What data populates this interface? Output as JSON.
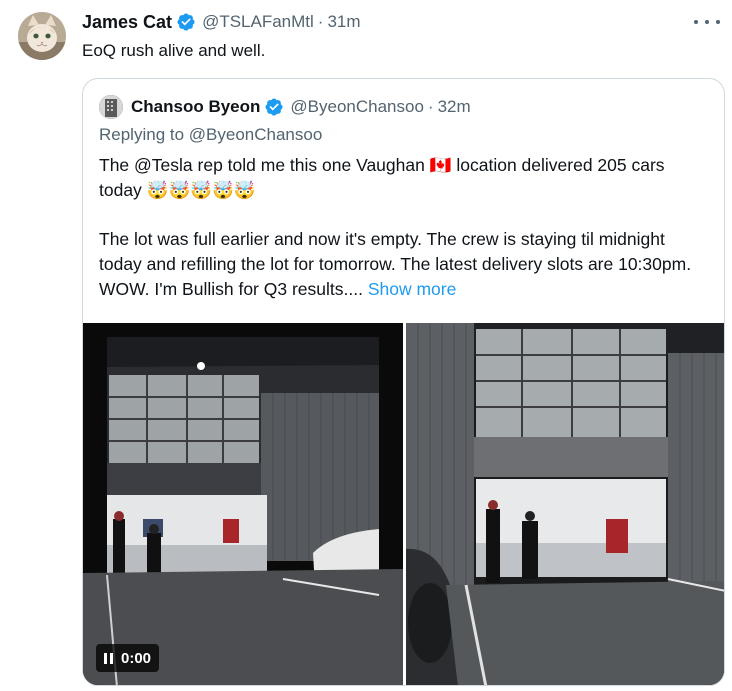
{
  "tweet": {
    "author_name": "James Cat",
    "handle": "@TSLAFanMtl",
    "separator": "·",
    "time": "31m",
    "text": "EoQ rush alive and well.",
    "more_icon": "more-horizontal-icon"
  },
  "quote": {
    "author_name": "Chansoo Byeon",
    "handle": "@ByeonChansoo",
    "separator": "·",
    "time": "32m",
    "replying_prefix": "Replying to ",
    "replying_handle": "@ByeonChansoo",
    "text_line1_a": "The ",
    "mention": "@Tesla",
    "text_line1_b": " rep told me this one Vaughan ",
    "flag": "🇨🇦",
    "text_line1_c": " location delivered 205 cars today ",
    "emojis": [
      "🤯",
      "🤯",
      "🤯",
      "🤯",
      "🤯"
    ],
    "text_para2": "The lot was full earlier and now it's empty. The crew is staying til midnight today and refilling the lot for tomorrow. The latest delivery slots are 10:30pm. WOW. I'm Bullish for Q3 results....",
    "show_more": "Show more",
    "video_time": "0:00"
  },
  "colors": {
    "link": "#1d9bf0",
    "secondary_text": "#536471",
    "border": "#cfd9de",
    "verified": "#1d9bf0"
  }
}
